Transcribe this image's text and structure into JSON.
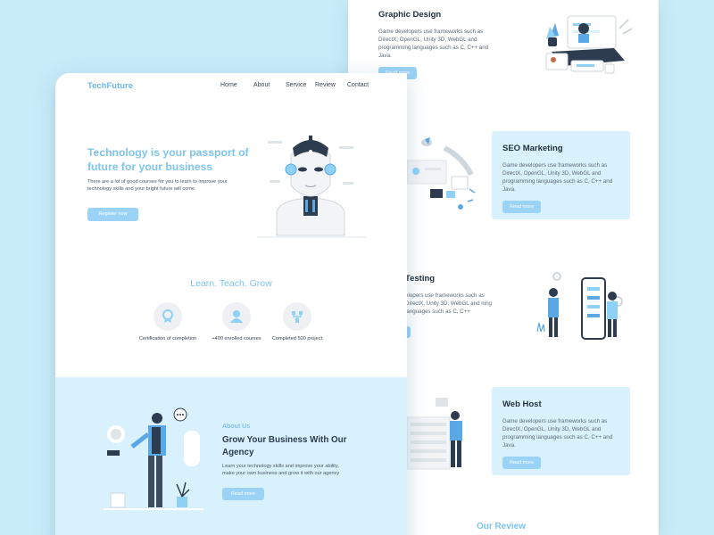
{
  "back_page": {
    "services": [
      {
        "title": "Graphic Design",
        "text": "Game developers use frameworks such as DirectX, OpenGL, Unity 3D, WebGL and programming languages such as C, C++ and Java.",
        "button": "Read more"
      },
      {
        "title": "SEO Marketing",
        "text": "Game developers use frameworks such as DirectX, OpenGL, Unity 3D, WebGL and programming languages such as C, C++ and Java.",
        "button": "Read more"
      },
      {
        "title": "Testing",
        "text": "elopers use frameworks such as DirectX, Unity 3D, WebGL and ning languages such as C, C++"
      },
      {
        "title": "Web Host",
        "text": "Game developers use frameworks such as DirectX, OpenGL, Unity 3D, WebGL and programming languages such as C, C++ and Java.",
        "button": "Read more"
      }
    ],
    "review_title": "Our Review"
  },
  "front_page": {
    "logo": "TechFuture",
    "nav": [
      "Home",
      "About",
      "Service",
      "Review",
      "Contact"
    ],
    "hero": {
      "title": "Technology is your passport of future for your business",
      "text": "There are a lot of good courses for you to learn to improve your technology skills and your bright future will come.",
      "button": "Register now"
    },
    "learn_title": "Learn. Teach. Grow",
    "stats": [
      "Certification of completion",
      "+400 enrolled courses",
      "Completed 500 project"
    ],
    "about": {
      "kicker": "About Us",
      "title": "Grow Your Business With Our Agency",
      "text": "Learn your technology skills and improve your ability, make your own business and grow it with our agency",
      "button": "Read more"
    }
  },
  "colors": {
    "accent": "#7fc4ef",
    "button": "#9bd3f7",
    "panel": "#d8f1fc",
    "background": "#c9ecf9"
  }
}
